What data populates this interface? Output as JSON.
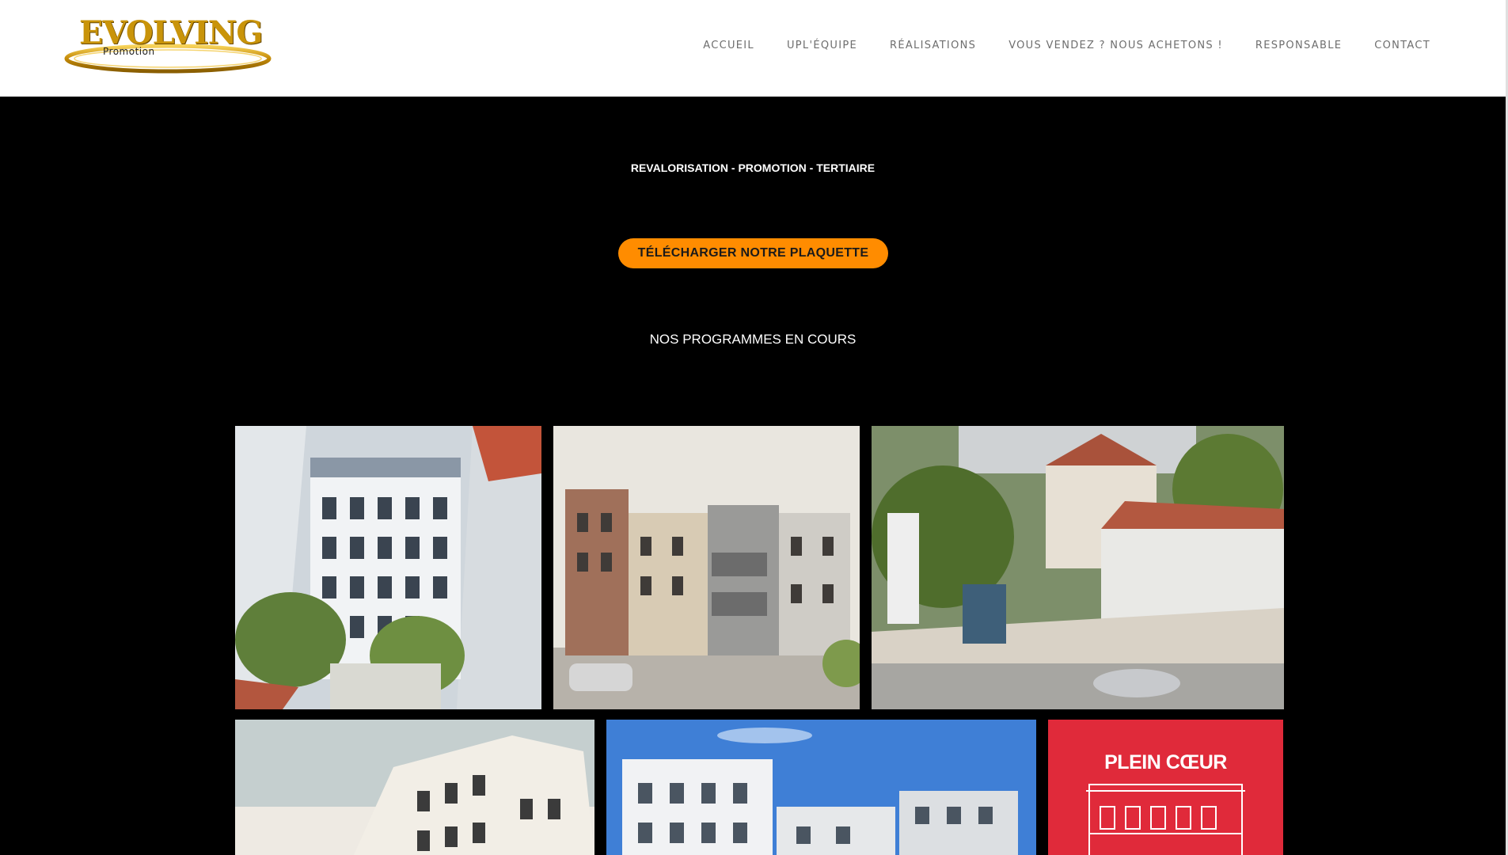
{
  "brand": {
    "logo_name": "Evolving",
    "logo_display": "EVOLVING",
    "logo_sub": "Promotion",
    "accent_gold": "#c9940a"
  },
  "nav": {
    "items": [
      {
        "label": "ACCUEIL"
      },
      {
        "label": "UPL'ÉQUIPE"
      },
      {
        "label": "RÉALISATIONS"
      },
      {
        "label": "VOUS VENDEZ ? NOUS ACHETONS !"
      },
      {
        "label": "RESPONSABLE"
      },
      {
        "label": "CONTACT"
      }
    ]
  },
  "hero": {
    "tagline": "REVALORISATION - PROMOTION - TERTIAIRE",
    "cta_label": "TÉLÉCHARGER NOTRE PLAQUETTE",
    "cta_color": "#ff8c00",
    "section_title": "NOS PROGRAMMES EN COURS"
  },
  "programs": {
    "poster_title": "PLEIN CŒUR",
    "poster_color": "#e02a3a"
  }
}
